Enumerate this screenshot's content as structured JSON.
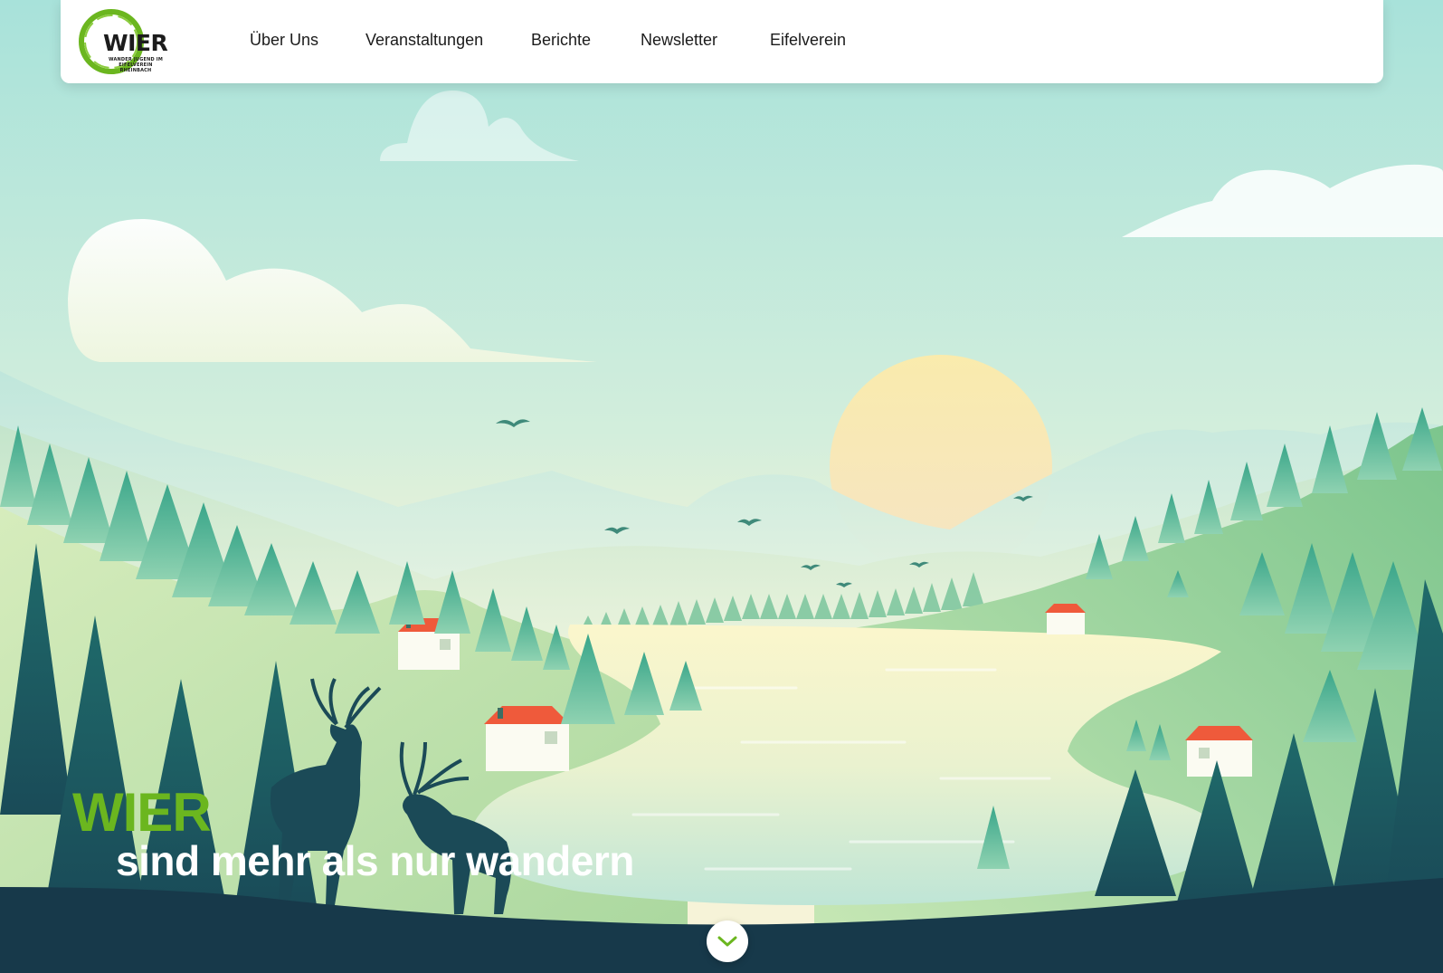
{
  "site": {
    "logo": {
      "word": "WIER",
      "subtitle": "WANDER JUGEND IM EIFELVEREIN RHEINBACH",
      "icon": "green-brush-ring-logo"
    },
    "nav": [
      {
        "label": "Über Uns"
      },
      {
        "label": "Veranstaltungen"
      },
      {
        "label": "Berichte"
      },
      {
        "label": "Newsletter"
      },
      {
        "label": "Eifelverein"
      }
    ]
  },
  "hero": {
    "brand": "WIER",
    "tagline": "sind mehr als nur wandern",
    "scroll_icon": "chevron-down-icon"
  },
  "colors": {
    "brand_green": "#6bb61f",
    "sky_top": "#a8e2da",
    "sun": "#f8e7b4",
    "roof": "#ef5a3b",
    "ground": "#17394a"
  }
}
